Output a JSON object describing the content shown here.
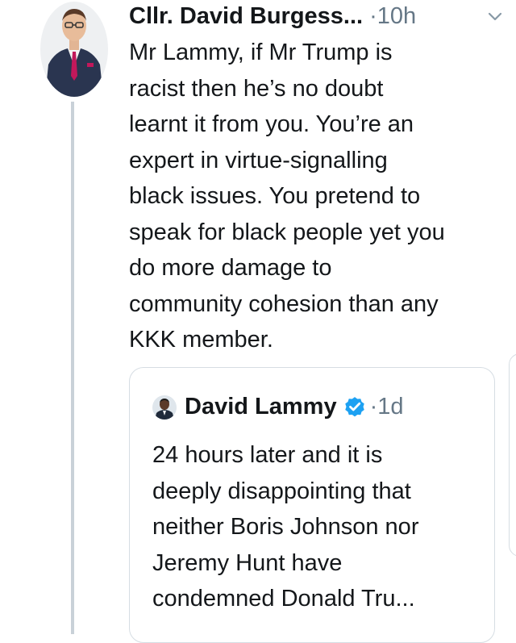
{
  "tweet": {
    "author_name": "Cllr. David Burgess...",
    "time": "·10h",
    "text_lines": [
      "Mr Lammy, if Mr Trump is",
      "racist then he’s no doubt",
      "learnt it from you. You’re an",
      "expert in virtue-signalling",
      "black issues. You pretend to",
      "speak for black people yet you",
      "do more damage to",
      "community cohesion than any",
      "KKK member."
    ],
    "icons": {
      "avatar": "profile-photo",
      "menu": "chevron-down-icon"
    }
  },
  "quoted_tweet": {
    "author_name": "David Lammy",
    "time": "·1d",
    "verified": true,
    "text_lines": [
      "24 hours later and it is",
      "deeply disappointing that",
      "neither Boris Johnson nor",
      "Jeremy Hunt have",
      "condemned Donald Tru..."
    ],
    "icons": {
      "avatar": "profile-photo",
      "badge": "verified-badge-icon"
    }
  },
  "colors": {
    "text": "#14171a",
    "secondary_text": "#657786",
    "verified_blue": "#1da1f2",
    "border": "#d6dde3",
    "thread_line": "#c9d1d8"
  }
}
